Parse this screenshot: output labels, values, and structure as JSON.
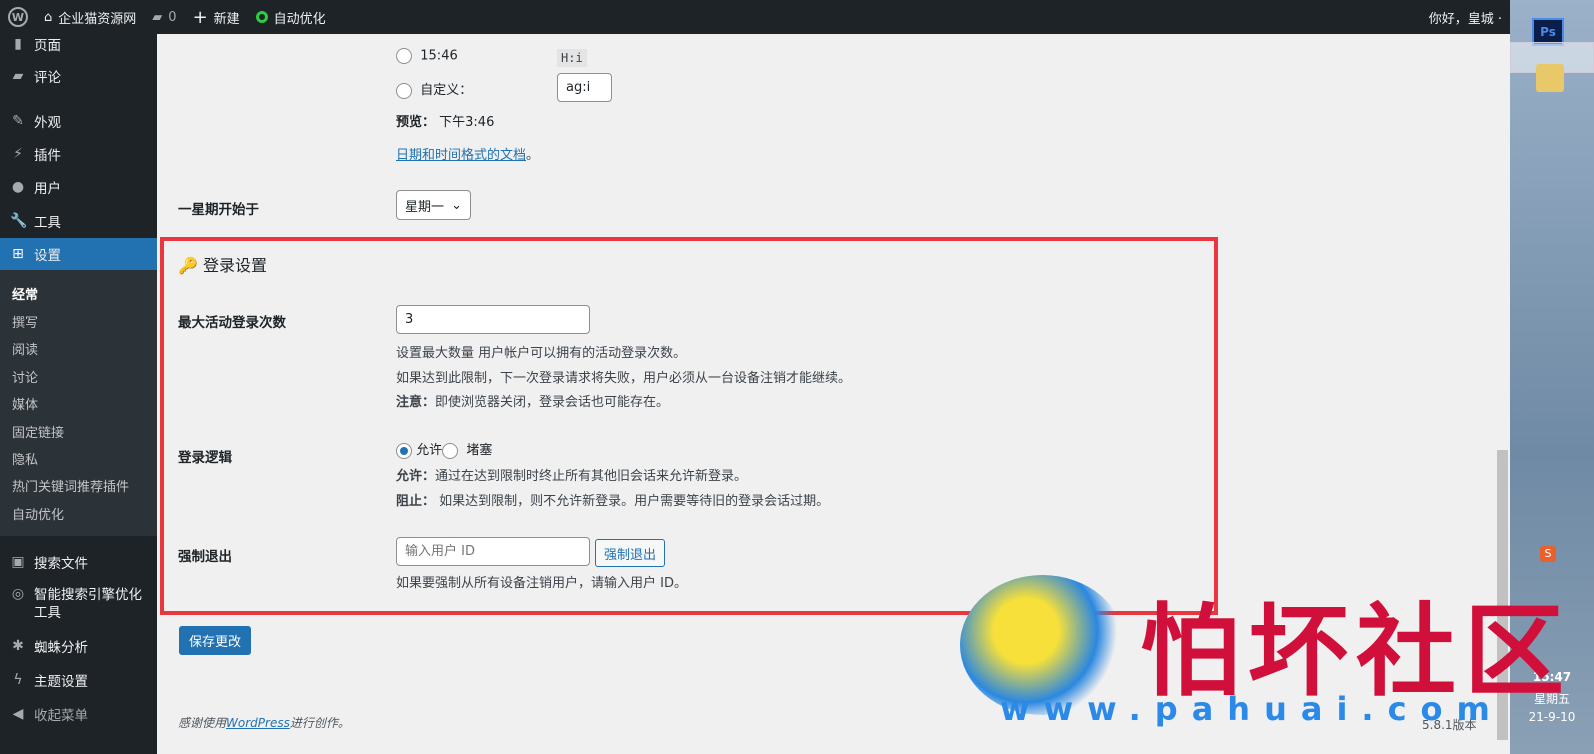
{
  "adminbar": {
    "site": "企业猫资源网",
    "comments": "0",
    "new": "新建",
    "auto": "自动优化",
    "greeting": "你好，皇城 ·"
  },
  "sidebar": {
    "items": [
      "页面",
      "评论",
      "外观",
      "插件",
      "用户",
      "工具",
      "设置"
    ],
    "submenu": [
      "经常",
      "撰写",
      "阅读",
      "讨论",
      "媒体",
      "固定链接",
      "隐私",
      "热门关键词推荐插件",
      "自动优化"
    ],
    "more": [
      "搜索文件",
      "智能搜索引擎优化工具",
      "蜘蛛分析",
      "主题设置",
      "收起菜单"
    ]
  },
  "time": {
    "option1": "15:46",
    "format1": "H:i",
    "custom_label": "自定义：",
    "custom_value": "ag:i",
    "preview_label": "预览：",
    "preview_value": "下午3:46",
    "doc_link": "日期和时间格式的文档",
    "doc_suffix": "。"
  },
  "week": {
    "label": "一星期开始于",
    "value": "星期一"
  },
  "login": {
    "title": "登录设置",
    "max_label": "最大活动登录次数",
    "max_value": "3",
    "max_desc1": "设置最大数量 用户帐户可以拥有的活动登录次数。",
    "max_desc2": "如果达到此限制，下一次登录请求将失败，用户必须从一台设备注销才能继续。",
    "note_label": "注意：",
    "note_text": "即使浏览器关闭，登录会话也可能存在。",
    "logic_label": "登录逻辑",
    "opt_allow": "允许",
    "opt_block": "堵塞",
    "allow_label": "允许：",
    "allow_text": "通过在达到限制时终止所有其他旧会话来允许新登录。",
    "block_label": "阻止：",
    "block_text": " 如果达到限制，则不允许新登录。用户需要等待旧的登录会话过期。",
    "force_label": "强制退出",
    "force_placeholder": "输入用户 ID",
    "force_button": "强制退出",
    "force_desc": "如果要强制从所有设备注销用户，请输入用户 ID。"
  },
  "save": "保存更改",
  "footer": {
    "thanks_pre": "感谢使用",
    "thanks_link": "WordPress",
    "thanks_post": "进行创作。",
    "version": "5.8.1版本"
  },
  "taskbar": {
    "time": "15:47",
    "weekday": "星期五",
    "date": "21-9-10",
    "ps": "Ps"
  },
  "watermark": {
    "brand": "怕坏社区",
    "url": "www.pahuai.com"
  }
}
